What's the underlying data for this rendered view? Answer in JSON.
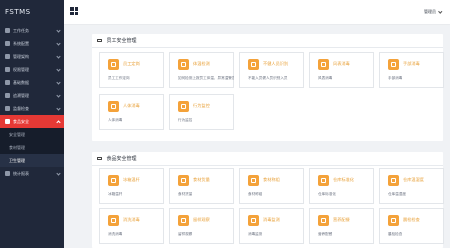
{
  "app": {
    "brand": "FSTMS"
  },
  "header": {
    "user": "管理员"
  },
  "sidebar": {
    "items": [
      {
        "label": "工作任务",
        "icon": "task-icon"
      },
      {
        "label": "系统配置",
        "icon": "settings-icon"
      },
      {
        "label": "管理架构",
        "icon": "structure-icon"
      },
      {
        "label": "权限管理",
        "icon": "permission-icon"
      },
      {
        "label": "基础数据",
        "icon": "database-icon"
      },
      {
        "label": "追溯管理",
        "icon": "trace-icon"
      },
      {
        "label": "监督检查",
        "icon": "inspection-icon"
      },
      {
        "label": "食品安全",
        "icon": "food-safety-icon",
        "active": true
      }
    ],
    "submenu": [
      {
        "label": "安全管理"
      },
      {
        "label": "食材管理",
        "selected": true
      },
      {
        "label": "卫生管理"
      }
    ],
    "after": [
      {
        "label": "统计报表",
        "icon": "report-icon"
      }
    ]
  },
  "sections": [
    {
      "title": "员工安全管理",
      "cards": [
        {
          "title": "员工定岗",
          "desc": "员工工作定岗"
        },
        {
          "title": "体温检测",
          "desc": "如何检测上报员工体温，异常温警告记录等"
        },
        {
          "title": "不健人员识别",
          "desc": "不能入员健人员识别入员"
        },
        {
          "title": "风表消毒",
          "desc": "风表消毒"
        },
        {
          "title": "手部消毒",
          "desc": "手部消毒"
        },
        {
          "title": "人体消毒",
          "desc": "人体消毒"
        },
        {
          "title": "行为监控",
          "desc": "行为监控"
        }
      ]
    },
    {
      "title": "食品安全管理",
      "cards": [
        {
          "title": "冰箱温杆",
          "desc": "冰箱温杆"
        },
        {
          "title": "食材货量",
          "desc": "食材货量"
        },
        {
          "title": "食材称组",
          "desc": "食材称组"
        },
        {
          "title": "仓库标准化",
          "desc": "仓库标准化"
        },
        {
          "title": "仓库温湿度",
          "desc": "仓库温湿度"
        },
        {
          "title": "消洗消毒",
          "desc": "消洗消毒"
        },
        {
          "title": "留样观察",
          "desc": "留样观察"
        },
        {
          "title": "消毒监测",
          "desc": "消毒监测"
        },
        {
          "title": "营养配餐",
          "desc": "营养配餐"
        },
        {
          "title": "晨检检查",
          "desc": "晨检检查"
        }
      ]
    }
  ]
}
